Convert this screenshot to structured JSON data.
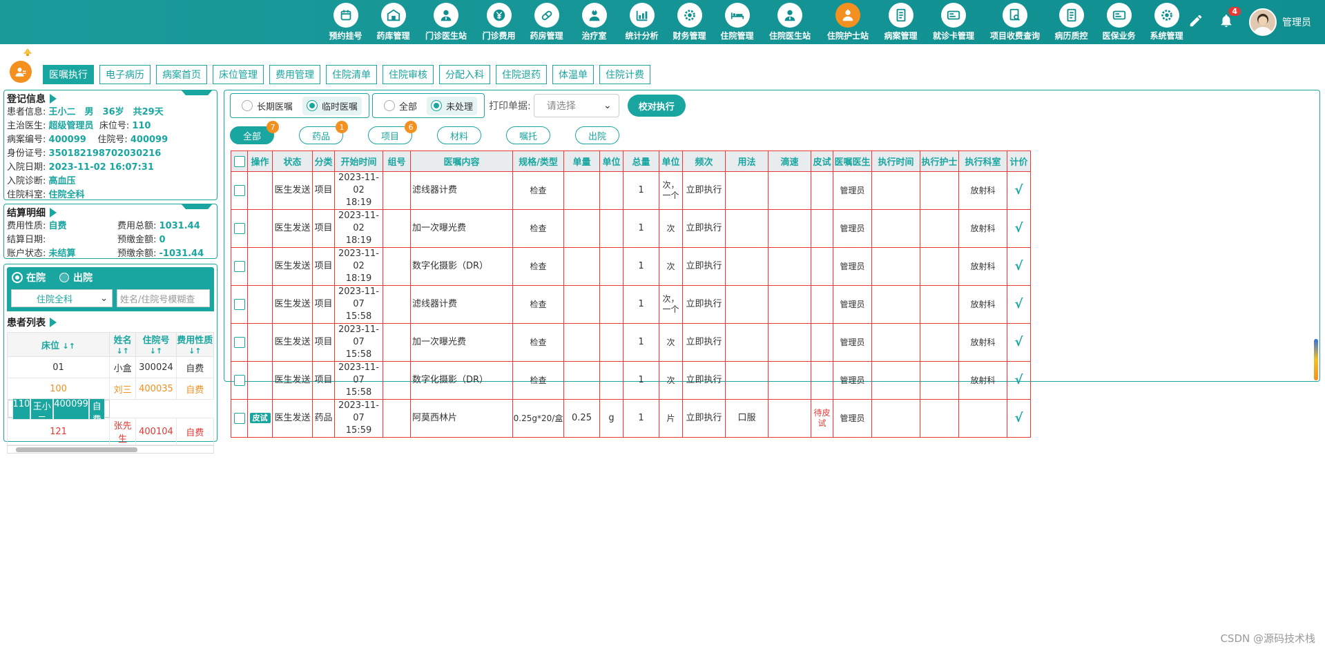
{
  "nav": [
    {
      "label": "预约挂号",
      "icon": "calendar-icon"
    },
    {
      "label": "药库管理",
      "icon": "warehouse-icon"
    },
    {
      "label": "门诊医生站",
      "icon": "doctor-icon"
    },
    {
      "label": "门诊费用",
      "icon": "yen-icon"
    },
    {
      "label": "药房管理",
      "icon": "pill-icon"
    },
    {
      "label": "治疗室",
      "icon": "nurse-icon"
    },
    {
      "label": "统计分析",
      "icon": "chart-icon"
    },
    {
      "label": "财务管理",
      "icon": "gear-icon"
    },
    {
      "label": "住院管理",
      "icon": "bed-icon"
    },
    {
      "label": "住院医生站",
      "icon": "doctor-icon"
    },
    {
      "label": "住院护士站",
      "icon": "nurse-icon"
    },
    {
      "label": "病案管理",
      "icon": "record-icon"
    },
    {
      "label": "就诊卡管理",
      "icon": "card-icon"
    },
    {
      "label": "项目收费查询",
      "icon": "search-icon"
    },
    {
      "label": "病历质控",
      "icon": "record-icon"
    },
    {
      "label": "医保业务",
      "icon": "card-icon"
    },
    {
      "label": "系统管理",
      "icon": "gear-icon"
    }
  ],
  "nav_active_index": 10,
  "user": {
    "name": "管理员",
    "notifications": "4"
  },
  "subtabs": [
    "医嘱执行",
    "电子病历",
    "病案首页",
    "床位管理",
    "费用管理",
    "住院清单",
    "住院审核",
    "分配入科",
    "住院退药",
    "体温单",
    "住院计费"
  ],
  "reg": {
    "title": "登记信息",
    "patient_label": "患者信息:",
    "patient_value": "王小二　男　36岁　共29天",
    "doctor_label": "主治医生:",
    "doctor_value": "超级管理员",
    "bed_label": "床位号:",
    "bed_value": "110",
    "case_label": "病案编号:",
    "case_value": "400099",
    "inpatient_label": "住院号:",
    "inpatient_value": "400099",
    "id_label": "身份证号:",
    "id_value": "350182198702030216",
    "admit_date_label": "入院日期:",
    "admit_date_value": "2023-11-02 16:07:31",
    "diag_label": "入院诊断:",
    "diag_value": "高血压",
    "dept_label": "住院科室:",
    "dept_value": "住院全科"
  },
  "fee": {
    "title": "结算明细",
    "type_label": "费用性质:",
    "type_value": "自费",
    "total_label": "费用总额:",
    "total_value": "1031.44",
    "settle_label": "结算日期:",
    "settle_value": "",
    "prepaid_label": "预缴金额:",
    "prepaid_value": "0",
    "status_label": "账户状态:",
    "status_value": "未结算",
    "balance_label": "预缴余额:",
    "balance_value": "-1031.44"
  },
  "patients": {
    "radio_in": "在院",
    "radio_out": "出院",
    "dept_select": "住院全科",
    "search_placeholder": "姓名/住院号模糊查",
    "title": "患者列表",
    "headers": [
      "床位",
      "姓名",
      "住院号",
      "费用性质"
    ],
    "rows": [
      {
        "bed": "01",
        "name": "小盒",
        "no": "300024",
        "type": "自费",
        "style": ""
      },
      {
        "bed": "100",
        "name": "刘三",
        "no": "400035",
        "type": "自费",
        "style": "orange"
      },
      {
        "bed": "110",
        "name": "王小二",
        "no": "400099",
        "type": "自费",
        "style": "sel"
      },
      {
        "bed": "121",
        "name": "张先生",
        "no": "400104",
        "type": "自费",
        "style": "red"
      }
    ]
  },
  "toolbar": {
    "long_term": "长期医嘱",
    "temporary": "临时医嘱",
    "all": "全部",
    "unprocessed": "未处理",
    "print_label": "打印单据:",
    "print_placeholder": "请选择",
    "verify_button": "校对执行"
  },
  "filters": [
    {
      "label": "全部",
      "count": "7"
    },
    {
      "label": "药品",
      "count": "1"
    },
    {
      "label": "项目",
      "count": "6"
    },
    {
      "label": "材料",
      "count": ""
    },
    {
      "label": "嘱托",
      "count": ""
    },
    {
      "label": "出院",
      "count": ""
    }
  ],
  "table": {
    "headers": [
      "操作",
      "状态",
      "分类",
      "开始时间",
      "组号",
      "医嘱内容",
      "规格/类型",
      "单量",
      "单位",
      "总量",
      "单位",
      "频次",
      "用法",
      "滴速",
      "皮试",
      "医嘱医生",
      "执行时间",
      "执行护士",
      "执行科室",
      "计价"
    ],
    "rows": [
      {
        "op": "",
        "status": "医生发送",
        "cat": "项目",
        "date": "2023-11-02",
        "time": "18:19",
        "group": "",
        "content": "滤线器计费",
        "spec": "检查",
        "dose": "",
        "unit": "",
        "total": "1",
        "tunit": "次，一个",
        "freq": "立即执行",
        "usage": "",
        "drip": "",
        "skin": "",
        "doctor": "管理员",
        "exec_time": "",
        "nurse": "",
        "dept": "放射科",
        "priced": "√"
      },
      {
        "op": "",
        "status": "医生发送",
        "cat": "项目",
        "date": "2023-11-02",
        "time": "18:19",
        "group": "",
        "content": "加一次曝光费",
        "spec": "检查",
        "dose": "",
        "unit": "",
        "total": "1",
        "tunit": "次",
        "freq": "立即执行",
        "usage": "",
        "drip": "",
        "skin": "",
        "doctor": "管理员",
        "exec_time": "",
        "nurse": "",
        "dept": "放射科",
        "priced": "√"
      },
      {
        "op": "",
        "status": "医生发送",
        "cat": "项目",
        "date": "2023-11-02",
        "time": "18:19",
        "group": "",
        "content": "数字化摄影（DR）",
        "spec": "检查",
        "dose": "",
        "unit": "",
        "total": "1",
        "tunit": "次",
        "freq": "立即执行",
        "usage": "",
        "drip": "",
        "skin": "",
        "doctor": "管理员",
        "exec_time": "",
        "nurse": "",
        "dept": "放射科",
        "priced": "√"
      },
      {
        "op": "",
        "status": "医生发送",
        "cat": "项目",
        "date": "2023-11-07",
        "time": "15:58",
        "group": "",
        "content": "滤线器计费",
        "spec": "检查",
        "dose": "",
        "unit": "",
        "total": "1",
        "tunit": "次，一个",
        "freq": "立即执行",
        "usage": "",
        "drip": "",
        "skin": "",
        "doctor": "管理员",
        "exec_time": "",
        "nurse": "",
        "dept": "放射科",
        "priced": "√"
      },
      {
        "op": "",
        "status": "医生发送",
        "cat": "项目",
        "date": "2023-11-07",
        "time": "15:58",
        "group": "",
        "content": "加一次曝光费",
        "spec": "检查",
        "dose": "",
        "unit": "",
        "total": "1",
        "tunit": "次",
        "freq": "立即执行",
        "usage": "",
        "drip": "",
        "skin": "",
        "doctor": "管理员",
        "exec_time": "",
        "nurse": "",
        "dept": "放射科",
        "priced": "√"
      },
      {
        "op": "",
        "status": "医生发送",
        "cat": "项目",
        "date": "2023-11-07",
        "time": "15:58",
        "group": "",
        "content": "数字化摄影（DR）",
        "spec": "检查",
        "dose": "",
        "unit": "",
        "total": "1",
        "tunit": "次",
        "freq": "立即执行",
        "usage": "",
        "drip": "",
        "skin": "",
        "doctor": "管理员",
        "exec_time": "",
        "nurse": "",
        "dept": "放射科",
        "priced": "√"
      },
      {
        "op": "皮试",
        "status": "医生发送",
        "cat": "药品",
        "date": "2023-11-07",
        "time": "15:59",
        "group": "",
        "content": "阿莫西林片",
        "spec": "0.25g*20/盒",
        "dose": "0.25",
        "unit": "g",
        "total": "1",
        "tunit": "片",
        "freq": "立即执行",
        "usage": "口服",
        "drip": "",
        "skin": "待皮试",
        "doctor": "管理员",
        "exec_time": "",
        "nurse": "",
        "dept": "",
        "priced": "√"
      }
    ]
  },
  "watermark": "CSDN @源码技术栈"
}
